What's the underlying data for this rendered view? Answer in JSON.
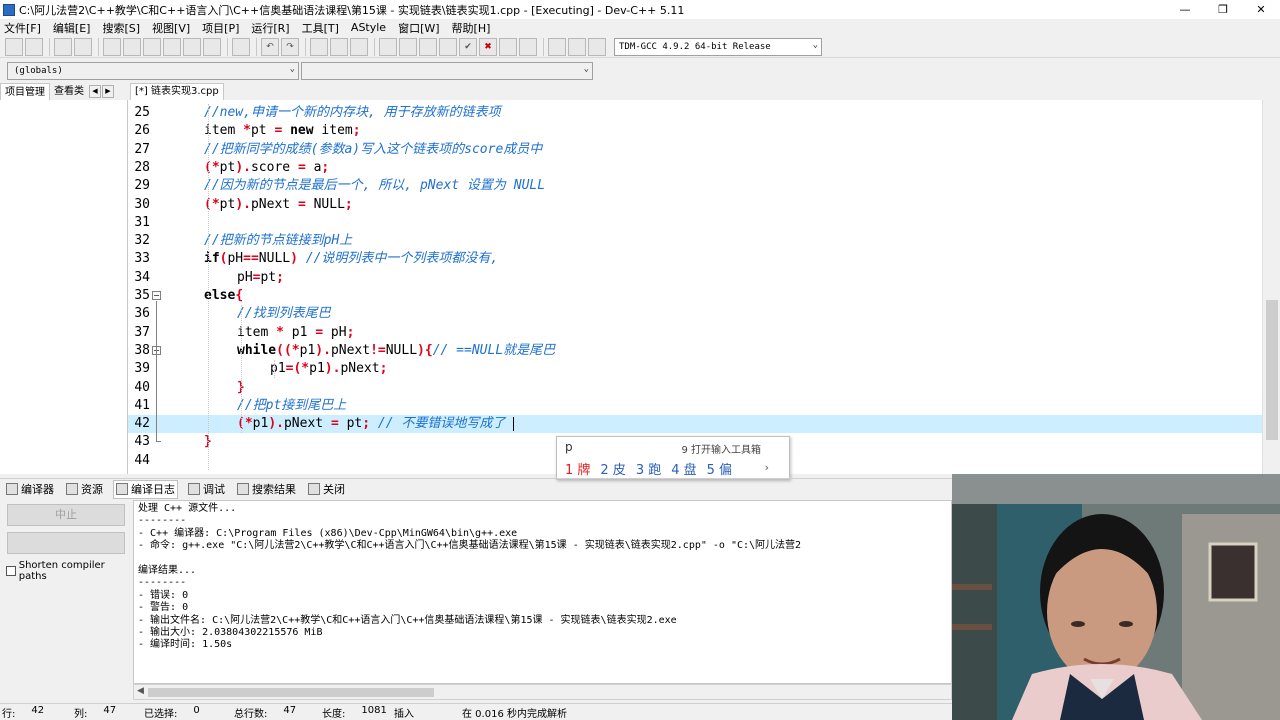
{
  "window": {
    "title": "C:\\阿儿法营2\\C++教学\\C和C++语言入门\\C++信奥基础语法课程\\第15课 - 实现链表\\链表实现1.cpp - [Executing] - Dev-C++ 5.11",
    "minimize": "—",
    "maximize": "❐",
    "close": "✕"
  },
  "menu": [
    "文件[F]",
    "编辑[E]",
    "搜索[S]",
    "视图[V]",
    "项目[P]",
    "运行[R]",
    "工具[T]",
    "AStyle",
    "窗口[W]",
    "帮助[H]"
  ],
  "toolbar": {
    "compiler": "TDM-GCC 4.9.2 64-bit Release"
  },
  "toolbar2": {
    "scope": "(globals)",
    "member": ""
  },
  "left_tabs": [
    "项目管理",
    "查看类"
  ],
  "editor_tab": "[*] 链表实现3.cpp",
  "editor": {
    "lines": [
      {
        "n": "25",
        "indent": 0,
        "parts": [
          [
            "cm",
            "//new,申请一个新的内存块, 用于存放新的链表项"
          ]
        ]
      },
      {
        "n": "26",
        "indent": 0,
        "parts": [
          [
            "t",
            "item "
          ],
          [
            "sym",
            "*"
          ],
          [
            "t",
            "pt "
          ],
          [
            "sym",
            "="
          ],
          [
            "t",
            " "
          ],
          [
            "kw",
            "new"
          ],
          [
            "t",
            " item"
          ],
          [
            "sym",
            ";"
          ]
        ]
      },
      {
        "n": "27",
        "indent": 0,
        "parts": [
          [
            "cm",
            "//把新同学的成绩(参数a)写入这个链表项的score成员中"
          ]
        ]
      },
      {
        "n": "28",
        "indent": 0,
        "parts": [
          [
            "sym",
            "(*"
          ],
          [
            "t",
            "pt"
          ],
          [
            "sym",
            ")."
          ],
          [
            "t",
            "score "
          ],
          [
            "sym",
            "="
          ],
          [
            "t",
            " a"
          ],
          [
            "sym",
            ";"
          ]
        ]
      },
      {
        "n": "29",
        "indent": 0,
        "parts": [
          [
            "cm",
            "//因为新的节点是最后一个, 所以, pNext 设置为 NULL"
          ]
        ]
      },
      {
        "n": "30",
        "indent": 0,
        "parts": [
          [
            "sym",
            "(*"
          ],
          [
            "t",
            "pt"
          ],
          [
            "sym",
            ")."
          ],
          [
            "t",
            "pNext "
          ],
          [
            "sym",
            "="
          ],
          [
            "t",
            " NULL"
          ],
          [
            "sym",
            ";"
          ]
        ]
      },
      {
        "n": "31",
        "indent": 0,
        "parts": []
      },
      {
        "n": "32",
        "indent": 0,
        "parts": [
          [
            "cm",
            "//把新的节点链接到pH上"
          ]
        ]
      },
      {
        "n": "33",
        "indent": 0,
        "parts": [
          [
            "kw",
            "if"
          ],
          [
            "sym",
            "("
          ],
          [
            "t",
            "pH"
          ],
          [
            "sym",
            "=="
          ],
          [
            "t",
            "NULL"
          ],
          [
            "sym",
            ")"
          ],
          [
            "t",
            " "
          ],
          [
            "cm",
            "//说明列表中一个列表项都没有,"
          ]
        ]
      },
      {
        "n": "34",
        "indent": 1,
        "parts": [
          [
            "t",
            "pH"
          ],
          [
            "sym",
            "="
          ],
          [
            "t",
            "pt"
          ],
          [
            "sym",
            ";"
          ]
        ]
      },
      {
        "n": "35",
        "indent": 0,
        "parts": [
          [
            "kw",
            "else"
          ],
          [
            "sym",
            "{"
          ]
        ]
      },
      {
        "n": "36",
        "indent": 1,
        "parts": [
          [
            "cm",
            "//找到列表尾巴"
          ]
        ]
      },
      {
        "n": "37",
        "indent": 1,
        "parts": [
          [
            "t",
            "item "
          ],
          [
            "sym",
            "*"
          ],
          [
            "t",
            " p1 "
          ],
          [
            "sym",
            "="
          ],
          [
            "t",
            " pH"
          ],
          [
            "sym",
            ";"
          ]
        ]
      },
      {
        "n": "38",
        "indent": 1,
        "parts": [
          [
            "kw",
            "while"
          ],
          [
            "sym",
            "((*"
          ],
          [
            "t",
            "p1"
          ],
          [
            "sym",
            ")."
          ],
          [
            "t",
            "pNext"
          ],
          [
            "sym",
            "!="
          ],
          [
            "t",
            "NULL"
          ],
          [
            "sym",
            "){"
          ],
          [
            "cm",
            "// ==NULL就是尾巴"
          ]
        ]
      },
      {
        "n": "39",
        "indent": 2,
        "parts": [
          [
            "t",
            "p1"
          ],
          [
            "sym",
            "=(*"
          ],
          [
            "t",
            "p1"
          ],
          [
            "sym",
            ")."
          ],
          [
            "t",
            "pNext"
          ],
          [
            "sym",
            ";"
          ]
        ]
      },
      {
        "n": "40",
        "indent": 1,
        "parts": [
          [
            "sym",
            "}"
          ]
        ]
      },
      {
        "n": "41",
        "indent": 1,
        "parts": [
          [
            "cm",
            "//把pt接到尾巴上"
          ]
        ]
      },
      {
        "n": "42",
        "indent": 1,
        "parts": [
          [
            "sym",
            "(*"
          ],
          [
            "t",
            "p1"
          ],
          [
            "sym",
            ")."
          ],
          [
            "t",
            "pNext "
          ],
          [
            "sym",
            "="
          ],
          [
            "t",
            " pt"
          ],
          [
            "sym",
            ";"
          ],
          [
            "t",
            " "
          ],
          [
            "cm",
            "// 不要错误地写成了 "
          ]
        ]
      },
      {
        "n": "43",
        "indent": 0,
        "parts": [
          [
            "sym",
            "}"
          ]
        ]
      },
      {
        "n": "44",
        "indent": 0,
        "parts": []
      }
    ],
    "current_line": "42"
  },
  "ime": {
    "pinyin": "p",
    "hint": "9 打开输入工具箱",
    "candidates": [
      "1 牌",
      "2 皮",
      "3 跑",
      "4 盘",
      "5 偏"
    ],
    "next": "›"
  },
  "bottom_tabs": [
    "编译器",
    "资源",
    "编译日志",
    "调试",
    "搜索结果",
    "关闭"
  ],
  "bottom_left": {
    "stop_button": "中止",
    "second_button": "",
    "shorten_label": "Shorten compiler paths"
  },
  "compile_log": [
    "处理 C++ 源文件...",
    "--------",
    "- C++ 编译器: C:\\Program Files (x86)\\Dev-Cpp\\MinGW64\\bin\\g++.exe",
    "- 命令: g++.exe \"C:\\阿儿法营2\\C++教学\\C和C++语言入门\\C++信奥基础语法课程\\第15课 - 实现链表\\链表实现2.cpp\" -o \"C:\\阿儿法营2",
    "",
    "编译结果...",
    "--------",
    "- 错误: 0",
    "- 警告: 0",
    "- 输出文件名: C:\\阿儿法营2\\C++教学\\C和C++语言入门\\C++信奥基础语法课程\\第15课 - 实现链表\\链表实现2.exe",
    "- 输出大小: 2.03804302215576 MiB",
    "- 编译时间: 1.50s"
  ],
  "statusbar": [
    {
      "label": "行:",
      "value": "42",
      "w": 72
    },
    {
      "label": "列:",
      "value": "47",
      "w": 70
    },
    {
      "label": "已选择:",
      "value": "0",
      "w": 90
    },
    {
      "label": "总行数:",
      "value": "47",
      "w": 88
    },
    {
      "label": "长度:",
      "value": "1081",
      "w": 72
    },
    {
      "label": "插入",
      "value": "",
      "w": 68
    },
    {
      "label": "在 0.016 秒内完成解析",
      "value": "",
      "w": 200
    }
  ],
  "colors": {
    "comment": "#1e70d0",
    "symbol": "#e0001a",
    "current_line": "#cceeff"
  }
}
